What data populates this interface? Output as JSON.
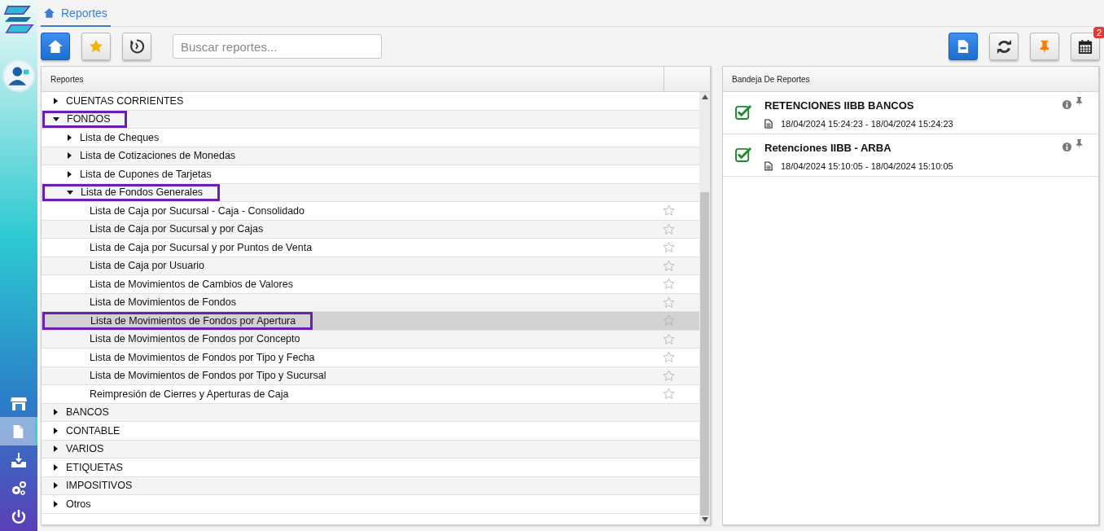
{
  "sidebar": {
    "items": [
      {
        "selected": false
      },
      {
        "selected": true
      },
      {
        "selected": false
      },
      {
        "selected": false
      },
      {
        "selected": false
      }
    ]
  },
  "breadcrumb": "Reportes",
  "toolbar": {
    "left": [
      {
        "active": true
      },
      {
        "active": false
      },
      {
        "active": false
      }
    ],
    "search": {
      "placeholder": "Buscar reportes..."
    },
    "right": [
      {
        "active": true
      },
      {
        "active": false
      },
      {
        "active": false
      },
      {
        "active": false,
        "badge": "2"
      }
    ]
  },
  "reports": {
    "title": "Reportes",
    "tree": [
      {
        "kind": "folder",
        "label": "CUENTAS CORRIENTES",
        "expanded": false,
        "outlined": false,
        "selected": false
      },
      {
        "kind": "folder",
        "label": "FONDOS",
        "expanded": true,
        "outlined": true,
        "selected": false,
        "children": [
          {
            "kind": "folder",
            "label": "Lista de Cheques",
            "expanded": false,
            "outlined": false,
            "selected": false
          },
          {
            "kind": "folder",
            "label": "Lista de Cotizaciones de Monedas",
            "expanded": false,
            "outlined": false,
            "selected": false
          },
          {
            "kind": "folder",
            "label": "Lista de Cupones de Tarjetas",
            "expanded": false,
            "outlined": false,
            "selected": false
          },
          {
            "kind": "folder",
            "label": "Lista de Fondos Generales",
            "expanded": true,
            "outlined": true,
            "selected": false,
            "children": [
              {
                "kind": "report",
                "label": "Lista de Caja por Sucursal - Caja - Consolidado",
                "outlined": false,
                "selected": false
              },
              {
                "kind": "report",
                "label": "Lista de Caja por Sucursal y por Cajas",
                "outlined": false,
                "selected": false
              },
              {
                "kind": "report",
                "label": "Lista de Caja por Sucursal y por Puntos de Venta",
                "outlined": false,
                "selected": false
              },
              {
                "kind": "report",
                "label": "Lista de Caja por Usuario",
                "outlined": false,
                "selected": false
              },
              {
                "kind": "report",
                "label": "Lista de Movimientos de Cambios de Valores",
                "outlined": false,
                "selected": false
              },
              {
                "kind": "report",
                "label": "Lista de Movimientos de Fondos",
                "outlined": false,
                "selected": false
              },
              {
                "kind": "report",
                "label": "Lista de Movimientos de Fondos por Apertura",
                "outlined": true,
                "selected": true
              },
              {
                "kind": "report",
                "label": "Lista de Movimientos de Fondos por Concepto",
                "outlined": false,
                "selected": false
              },
              {
                "kind": "report",
                "label": "Lista de Movimientos de Fondos por Tipo y Fecha",
                "outlined": false,
                "selected": false
              },
              {
                "kind": "report",
                "label": "Lista de Movimientos de Fondos por Tipo y Sucursal",
                "outlined": false,
                "selected": false
              },
              {
                "kind": "report",
                "label": "Reimpresión de Cierres y Aperturas de Caja",
                "outlined": false,
                "selected": false
              }
            ]
          }
        ]
      },
      {
        "kind": "folder",
        "label": "BANCOS",
        "expanded": false,
        "outlined": false,
        "selected": false
      },
      {
        "kind": "folder",
        "label": "CONTABLE",
        "expanded": false,
        "outlined": false,
        "selected": false
      },
      {
        "kind": "folder",
        "label": "VARIOS",
        "expanded": false,
        "outlined": false,
        "selected": false
      },
      {
        "kind": "folder",
        "label": "ETIQUETAS",
        "expanded": false,
        "outlined": false,
        "selected": false
      },
      {
        "kind": "folder",
        "label": "IMPOSITIVOS",
        "expanded": false,
        "outlined": false,
        "selected": false
      },
      {
        "kind": "folder",
        "label": "Otros",
        "expanded": false,
        "outlined": false,
        "selected": false
      }
    ]
  },
  "tray": {
    "title": "Bandeja De Reportes",
    "items": [
      {
        "title": "RETENCIONES IIBB BANCOS",
        "range": "18/04/2024 15:24:23 - 18/04/2024 15:24:23",
        "done": true
      },
      {
        "title": "Retenciones IIBB - ARBA",
        "range": "18/04/2024 15:10:05 - 18/04/2024 15:10:05",
        "done": true
      }
    ]
  }
}
